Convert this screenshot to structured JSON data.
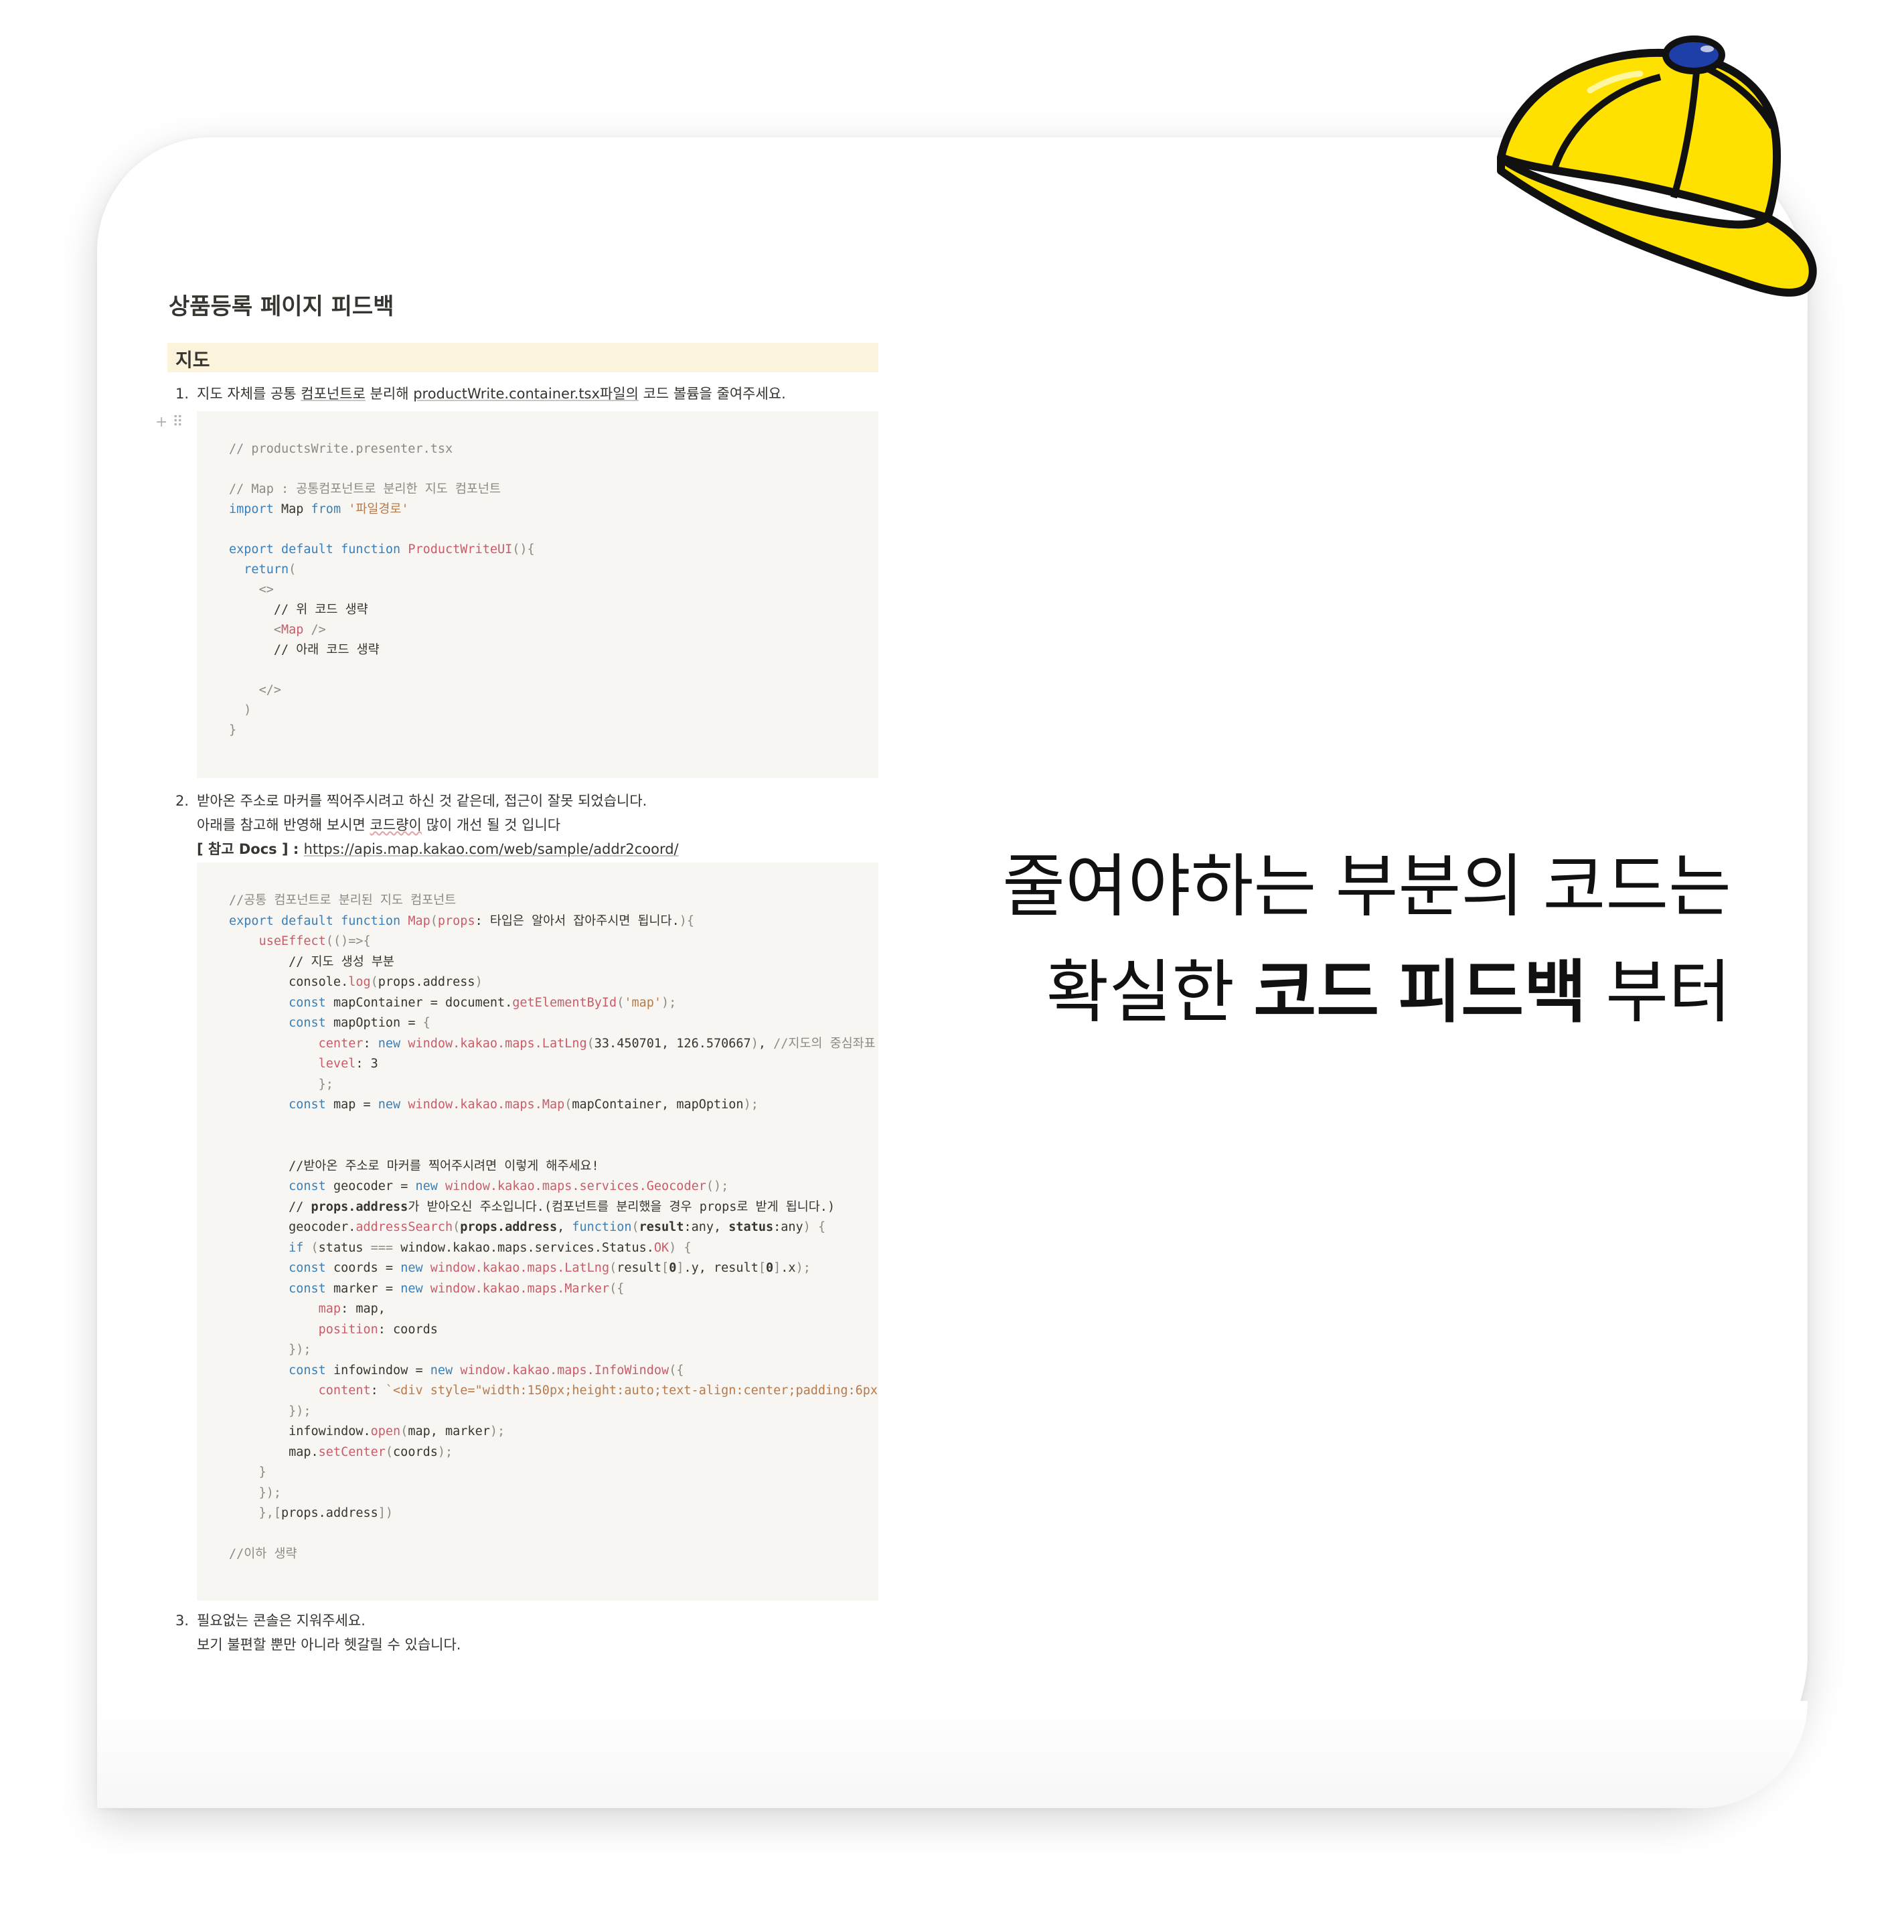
{
  "doc": {
    "title": "상품등록 페이지 피드백",
    "heading": "지도",
    "item1": {
      "num": "1.",
      "before": "지도 자체를 공통 ",
      "link_underlined": "컴포넌트로",
      "middle": " 분리해 ",
      "filename_underlined": "productWrite.container.tsx파일의",
      "after": " 코드 볼륨을 줄여주세요."
    },
    "item2": {
      "num": "2.",
      "line1": "받아온 주소로 마커를 찍어주시려고 하신 것 같은데, 접근이 잘못 되었습니다.",
      "line2_before": "아래를 참고해 반영해 보시면 ",
      "line2_underlined": "코드량이",
      "line2_after": " 많이 개선 될 것 입니다",
      "ref_label": "[ 참고 Docs ] : ",
      "ref_link": "https://apis.map.kakao.com/web/sample/addr2coord/"
    },
    "item3": {
      "num": "3.",
      "line1": "필요없는 콘솔은 지워주세요.",
      "line2": "보기 불편할 뿐만 아니라 헷갈릴 수 있습니다."
    },
    "block_controls": "+ ⠿"
  },
  "tagline": {
    "line1": "줄여야하는 부분의 코드는",
    "line2_regular_a": "확실한 ",
    "line2_bold": "코드 피드백",
    "line2_regular_b": " 부터"
  },
  "icons": {
    "cap": "yellow-cap-icon"
  },
  "colors": {
    "heading_bg": "#fbf3db",
    "code_bg": "#f7f6f3",
    "cap_yellow": "#ffe100",
    "cap_button": "#1f3fa8"
  }
}
